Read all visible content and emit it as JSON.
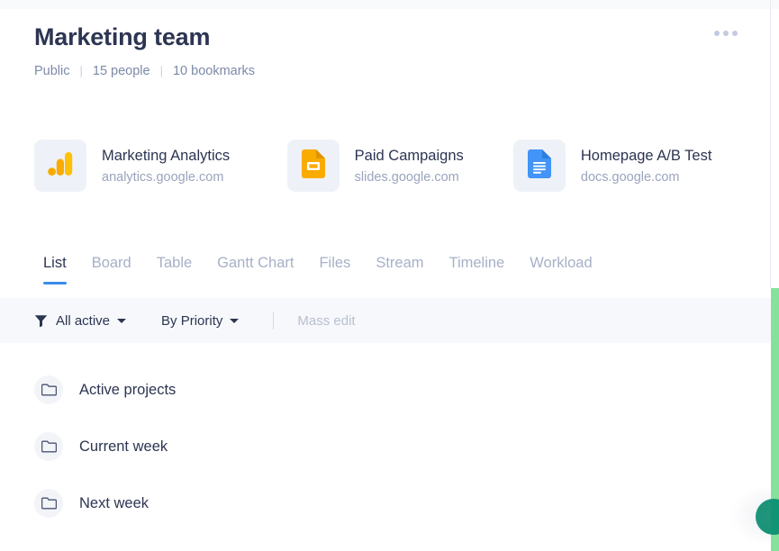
{
  "header": {
    "title": "Marketing team",
    "menu_icon": "kebab-menu-icon",
    "meta": [
      {
        "label": "Public"
      },
      {
        "label": "15 people"
      },
      {
        "label": "10 bookmarks"
      }
    ],
    "separator": "|"
  },
  "bookmarks": [
    {
      "title": "Marketing Analytics",
      "url": "analytics.google.com",
      "icon": "google-analytics-icon"
    },
    {
      "title": "Paid Campaigns",
      "url": "slides.google.com",
      "icon": "google-slides-icon"
    },
    {
      "title": "Homepage A/B Test",
      "url": "docs.google.com",
      "icon": "google-docs-icon"
    }
  ],
  "tabs": [
    {
      "label": "List",
      "active": true
    },
    {
      "label": "Board",
      "active": false
    },
    {
      "label": "Table",
      "active": false
    },
    {
      "label": "Gantt Chart",
      "active": false
    },
    {
      "label": "Files",
      "active": false
    },
    {
      "label": "Stream",
      "active": false
    },
    {
      "label": "Timeline",
      "active": false
    },
    {
      "label": "Workload",
      "active": false
    }
  ],
  "toolbar": {
    "filter_icon": "funnel-icon",
    "filter_label": "All active",
    "sort_label": "By Priority",
    "mass_edit_label": "Mass edit"
  },
  "list": {
    "items": [
      {
        "label": "Active projects",
        "icon": "folder-icon"
      },
      {
        "label": "Current week",
        "icon": "folder-icon"
      },
      {
        "label": "Next week",
        "icon": "folder-icon"
      }
    ]
  },
  "colors": {
    "accent_blue": "#3b8bef",
    "title_text": "#2c3552",
    "muted_text": "#9aa4bd",
    "toolbar_bg": "#f7f8fb",
    "rail_green": "#85e29a",
    "rail_bubble_teal": "#0f9474",
    "analytics_orange": "#f9ab00",
    "analytics_amber": "#ffc107",
    "slides_orange": "#f9ab00",
    "docs_blue": "#4294f7"
  }
}
